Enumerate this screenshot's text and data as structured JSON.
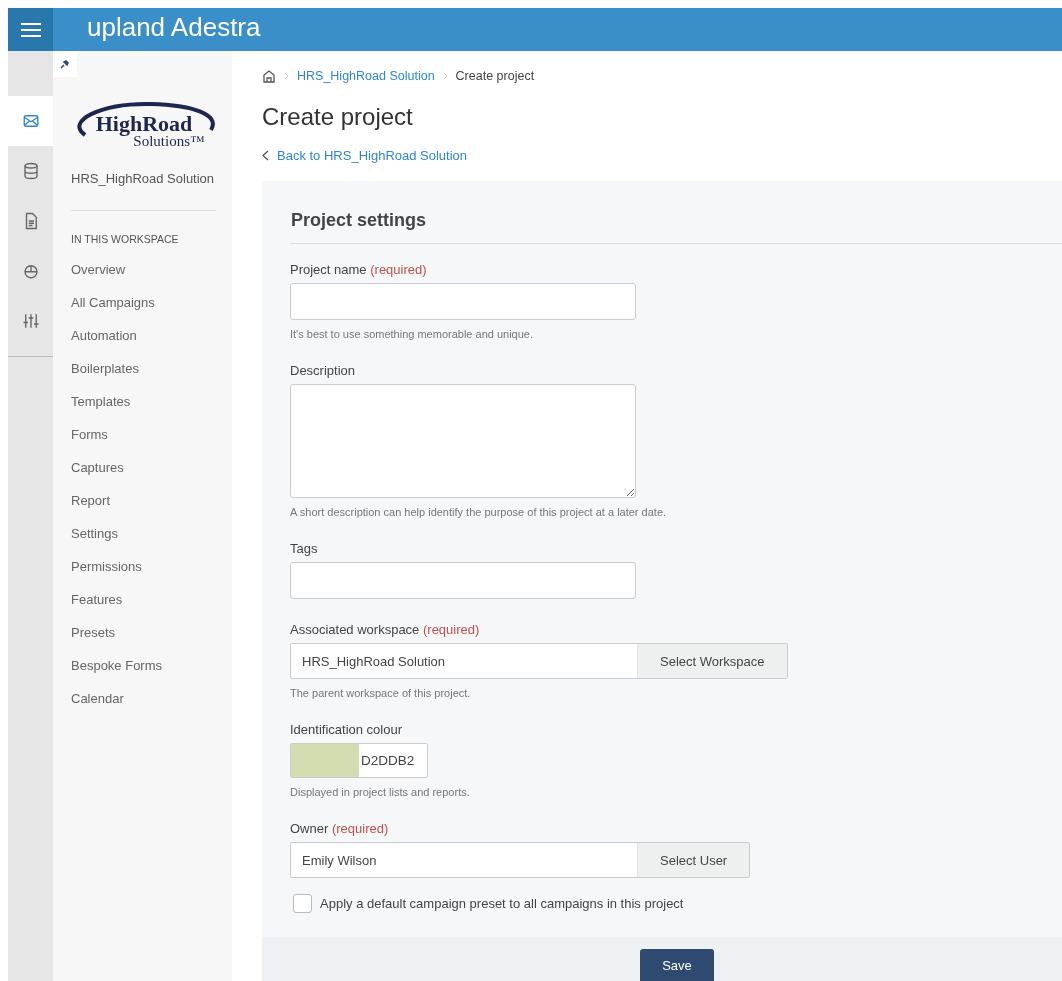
{
  "top_bar": {
    "brand": "upland Adestra"
  },
  "icon_rail": [
    {
      "kind": "envelope",
      "selected": true
    },
    {
      "kind": "database",
      "selected": false
    },
    {
      "kind": "document",
      "selected": false
    },
    {
      "kind": "pie",
      "selected": false
    },
    {
      "kind": "sliders",
      "selected": false
    }
  ],
  "sidebar": {
    "logo": {
      "line_1": "HighRoad",
      "line_2": "Solutions™"
    },
    "workspace_name": "HRS_HighRoad Solution",
    "heading": "IN THIS WORKSPACE",
    "items": [
      "Overview",
      "All Campaigns",
      "Automation",
      "Boilerplates",
      "Templates",
      "Forms",
      "Captures",
      "Report",
      "Settings",
      "Permissions",
      "Features",
      "Presets",
      "Bespoke Forms",
      "Calendar"
    ]
  },
  "breadcrumb": [
    "HRS_HighRoad Solution",
    "Create project"
  ],
  "title": "Create project",
  "back_link": "Back to HRS_HighRoad Solution",
  "form": {
    "heading": "Project settings",
    "fields": [
      {
        "kind": "text",
        "label": "Project name",
        "required": "(required)",
        "hint": "It's best to use something memorable and unique."
      },
      {
        "kind": "textarea",
        "label": "Description",
        "hint": "A short description can help identify the purpose of this project at a later date."
      },
      {
        "kind": "text",
        "label": "Tags"
      },
      {
        "kind": "picker",
        "label": "Associated workspace",
        "required": "(required)",
        "value": "HRS_HighRoad Solution",
        "button": "Select Workspace",
        "hint": "The parent workspace of this project."
      },
      {
        "kind": "colour",
        "label": "Identification colour",
        "value": "D2DDB2",
        "color": "#d2ddb2",
        "hint": "Displayed in project lists and reports."
      },
      {
        "kind": "picker",
        "label": "Owner",
        "required": "(required)",
        "value": "Emily Wilson",
        "button": "Select User"
      }
    ],
    "checkbox": {
      "label": "Apply a default campaign preset to all campaigns in this project",
      "checked": false
    },
    "save": "Save"
  }
}
